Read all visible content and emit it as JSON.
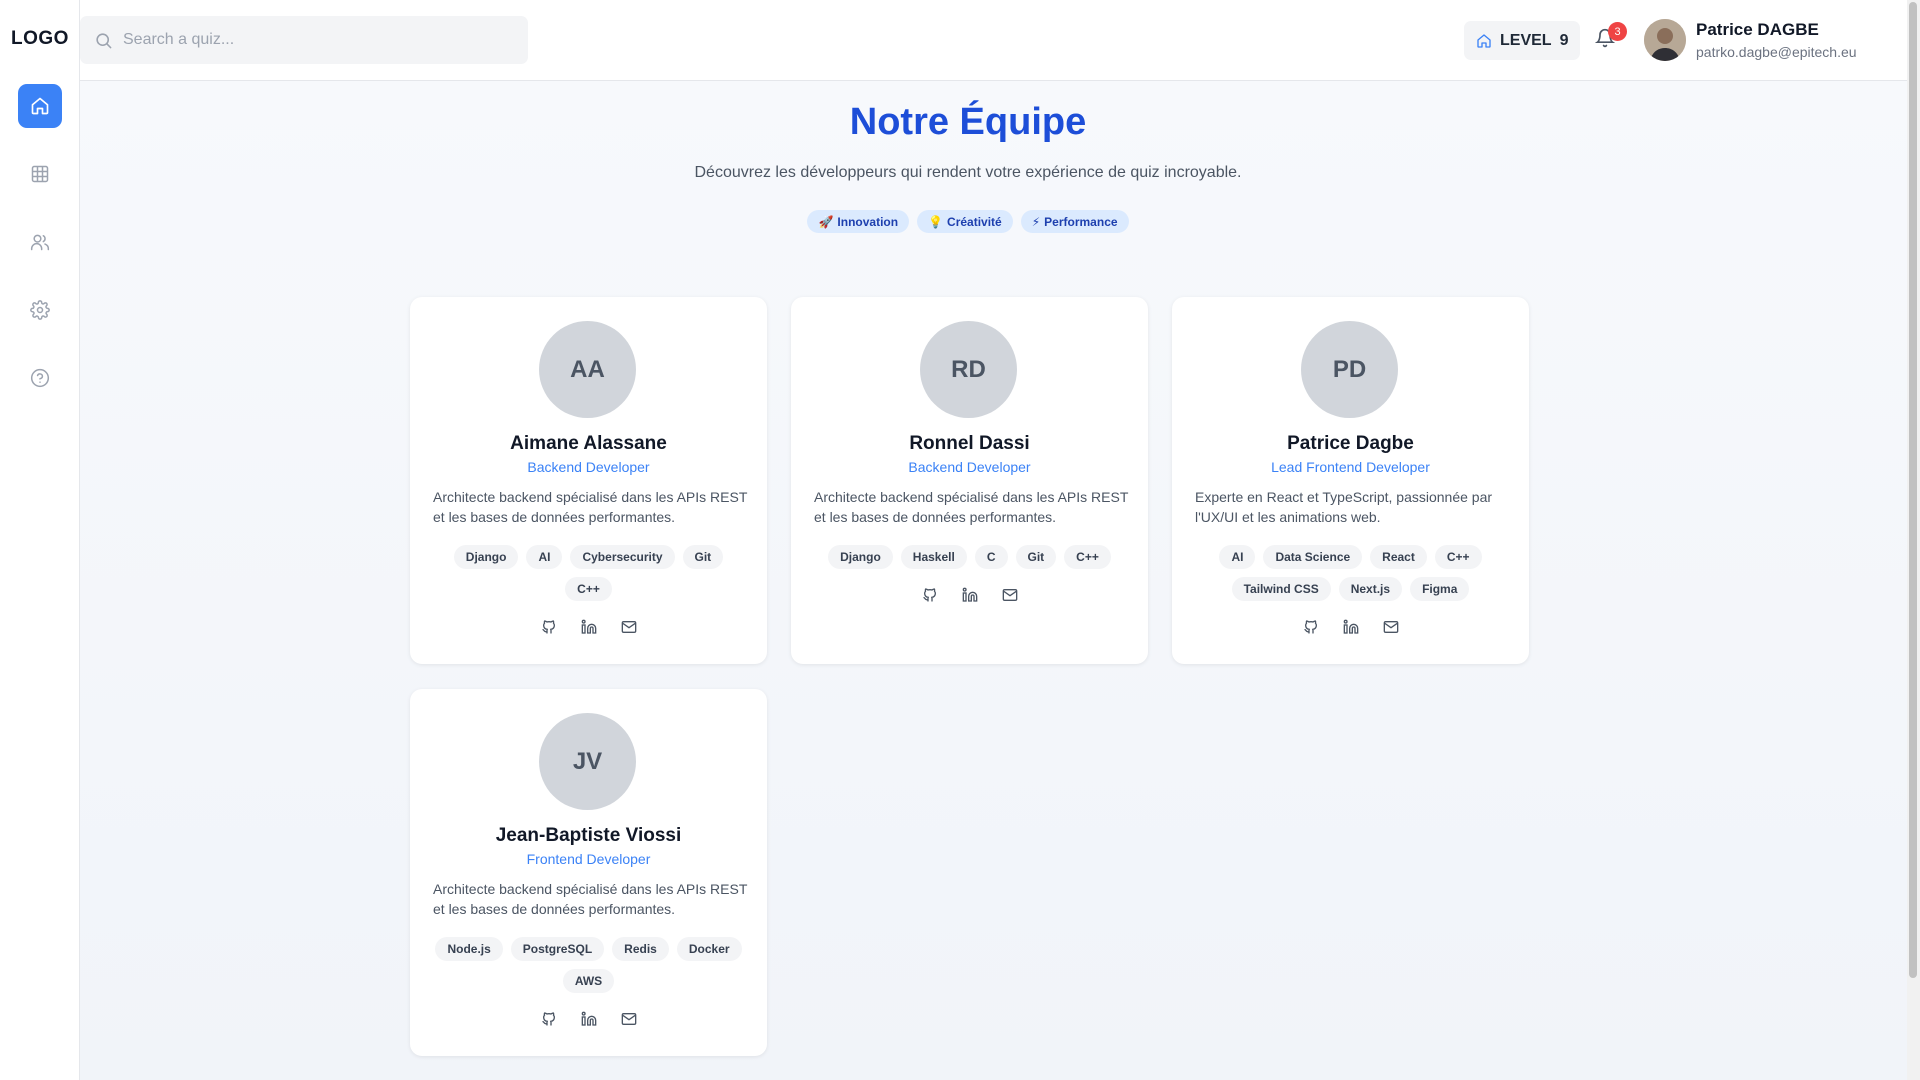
{
  "app": {
    "logo": "LOGO"
  },
  "sidebar": {
    "items": [
      {
        "name": "home",
        "icon": "home-icon",
        "active": true
      },
      {
        "name": "grid",
        "icon": "grid-icon",
        "active": false
      },
      {
        "name": "users",
        "icon": "users-icon",
        "active": false
      },
      {
        "name": "settings",
        "icon": "gear-icon",
        "active": false
      },
      {
        "name": "help",
        "icon": "help-circle-icon",
        "active": false
      }
    ]
  },
  "header": {
    "search": {
      "placeholder": "Search a quiz...",
      "value": ""
    },
    "level": {
      "label": "LEVEL",
      "value": "9"
    },
    "notifications": {
      "count": "3"
    },
    "user": {
      "name": "Patrice DAGBE",
      "email": "patrko.dagbe@epitech.eu"
    }
  },
  "page": {
    "title": "Notre Équipe",
    "subtitle": "Découvrez les développeurs qui rendent votre expérience de quiz incroyable.",
    "pills": [
      {
        "emoji": "🚀",
        "label": "Innovation"
      },
      {
        "emoji": "💡",
        "label": "Créativité"
      },
      {
        "emoji": "⚡",
        "label": "Performance"
      }
    ]
  },
  "team": [
    {
      "initials": "AA",
      "name": "Aimane Alassane",
      "role": "Backend Developer",
      "bio": "Architecte backend spécialisé dans les APIs REST et les bases de données performantes.",
      "skills": [
        "Django",
        "AI",
        "Cybersecurity",
        "Git",
        "C++"
      ]
    },
    {
      "initials": "RD",
      "name": "Ronnel Dassi",
      "role": "Backend Developer",
      "bio": "Architecte backend spécialisé dans les APIs REST et les bases de données performantes.",
      "skills": [
        "Django",
        "Haskell",
        "C",
        "Git",
        "C++"
      ]
    },
    {
      "initials": "PD",
      "name": "Patrice Dagbe",
      "role": "Lead Frontend Developer",
      "bio": "Experte en React et TypeScript, passionnée par l'UX/UI et les animations web.",
      "skills": [
        "AI",
        "Data Science",
        "React",
        "C++",
        "Tailwind CSS",
        "Next.js",
        "Figma"
      ]
    },
    {
      "initials": "JV",
      "name": "Jean-Baptiste Viossi",
      "role": "Frontend Developer",
      "bio": "Architecte backend spécialisé dans les APIs REST et les bases de données performantes.",
      "skills": [
        "Node.js",
        "PostgreSQL",
        "Redis",
        "Docker",
        "AWS"
      ]
    }
  ],
  "social_icons": [
    "github-icon",
    "linkedin-icon",
    "mail-icon"
  ],
  "colors": {
    "accent": "#3b82f6",
    "title": "#1d4ed8",
    "badge": "#ef4444",
    "pill_bg": "#dbeafe"
  }
}
